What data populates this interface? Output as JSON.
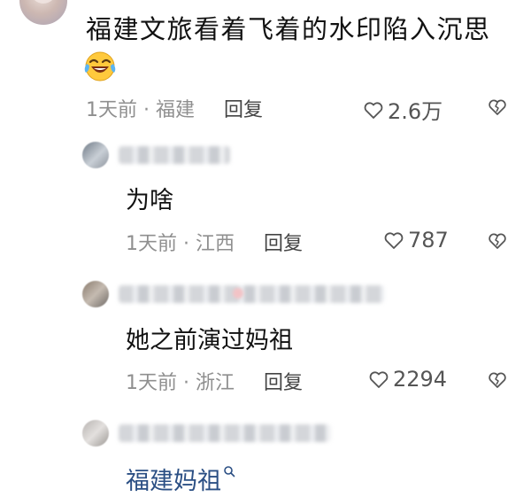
{
  "comment": {
    "text": "福建文旅看着飞着的水印陷入沉思",
    "emoji": "laughing-crying-emoji",
    "time": "1天前",
    "location": "福建",
    "reply_label": "回复",
    "likes": "2.6万"
  },
  "replies": [
    {
      "text": "为啥",
      "time": "1天前",
      "location": "江西",
      "reply_label": "回复",
      "likes": "787"
    },
    {
      "text": "她之前演过妈祖",
      "time": "1天前",
      "location": "浙江",
      "reply_label": "回复",
      "likes": "2294"
    },
    {
      "link_text": "福建妈祖"
    }
  ],
  "separator": "·",
  "colors": {
    "link": "#2b4f84",
    "meta": "#8f8f8f",
    "text": "#111111"
  }
}
